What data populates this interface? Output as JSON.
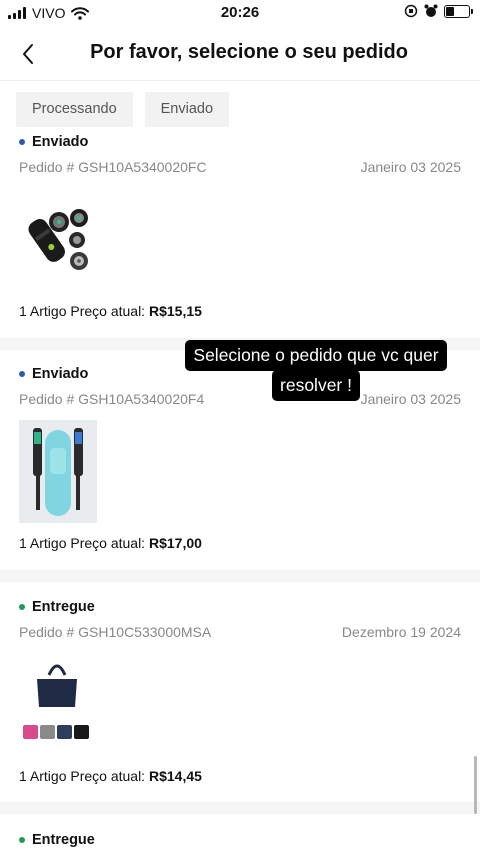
{
  "status_bar": {
    "carrier": "VIVO",
    "time": "20:26"
  },
  "header": {
    "title": "Por favor, selecione o seu pedido"
  },
  "filters": [
    "Processando",
    "Enviado"
  ],
  "orders": [
    {
      "status": "Enviado",
      "status_color": "#2a5db0",
      "order_id": "Pedido # GSH10A5340020FC",
      "date": "Janeiro 03 2025",
      "items_text": "1 Artigo Preço atual:",
      "price": "R$15,15",
      "image": "black-electric-shaver"
    },
    {
      "status": "Enviado",
      "status_color": "#2a5db0",
      "order_id": "Pedido # GSH10A5340020F4",
      "date": "Janeiro 03 2025",
      "items_text": "1 Artigo Preço atual:",
      "price": "R$17,00",
      "image": "toothbrush-set-with-case"
    },
    {
      "status": "Entregue",
      "status_color": "#1f9a55",
      "order_id": "Pedido # GSH10C533000MSA",
      "date": "Dezembro 19 2024",
      "items_text": "1 Artigo Preço atual:",
      "price": "R$14,45",
      "image": "tote-bag-color-variants"
    },
    {
      "status": "Entregue",
      "status_color": "#1f9a55"
    }
  ],
  "overlay": {
    "line1": "Selecione o pedido que vc quer",
    "line2": "resolver !"
  }
}
